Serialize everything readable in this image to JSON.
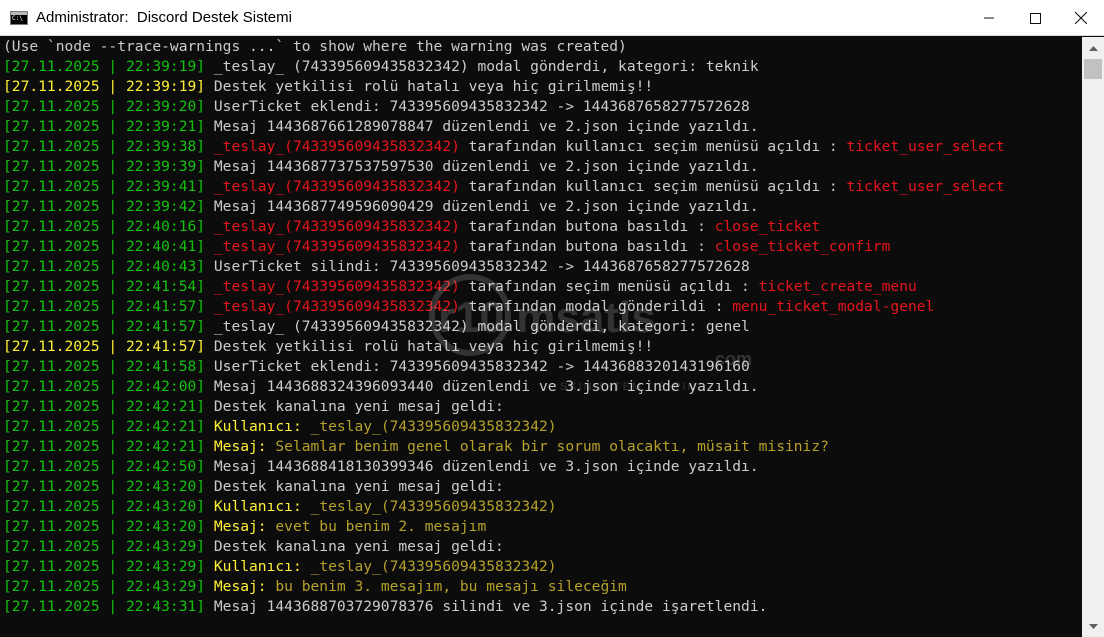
{
  "window": {
    "title": "Administrator:  Discord Destek Sistemi"
  },
  "colors": {
    "green": "#13c20e",
    "yellow": "#fff234",
    "white": "#cccccc",
    "red": "#e8141c",
    "dim_yellow": "#b5a12a"
  },
  "watermark": {
    "text": "r10 msatis",
    "sub": "SKIN / ITEM / E-PIN",
    "suffix": ".com"
  },
  "lines": [
    {
      "segments": [
        {
          "t": "(Use `node --trace-warnings ...` to show where the warning was created)",
          "c": "w"
        }
      ]
    },
    {
      "segments": [
        {
          "t": "[27.11.2025 | 22:39:19] ",
          "c": "g"
        },
        {
          "t": "_teslay_ (743395609435832342) modal gönderdi, kategori: teknik",
          "c": "w"
        }
      ]
    },
    {
      "segments": [
        {
          "t": "[27.11.2025 | 22:39:19] ",
          "c": "y"
        },
        {
          "t": "Destek yetkilisi rolü hatalı veya hiç girilmemiş!!",
          "c": "w"
        }
      ]
    },
    {
      "segments": [
        {
          "t": "[27.11.2025 | 22:39:20] ",
          "c": "g"
        },
        {
          "t": "UserTicket eklendi: 743395609435832342 -> 1443687658277572628",
          "c": "w"
        }
      ]
    },
    {
      "segments": [
        {
          "t": "[27.11.2025 | 22:39:21] ",
          "c": "g"
        },
        {
          "t": "Mesaj 1443687661289078847 düzenlendi ve 2.json içinde yazıldı.",
          "c": "w"
        }
      ]
    },
    {
      "segments": [
        {
          "t": "[27.11.2025 | 22:39:38] ",
          "c": "g"
        },
        {
          "t": "_teslay_(743395609435832342)",
          "c": "r"
        },
        {
          "t": " tarafından kullanıcı seçim menüsü açıldı : ",
          "c": "w"
        },
        {
          "t": "ticket_user_select",
          "c": "r"
        }
      ]
    },
    {
      "segments": [
        {
          "t": "[27.11.2025 | 22:39:39] ",
          "c": "g"
        },
        {
          "t": "Mesaj 1443687737537597530 düzenlendi ve 2.json içinde yazıldı.",
          "c": "w"
        }
      ]
    },
    {
      "segments": [
        {
          "t": "[27.11.2025 | 22:39:41] ",
          "c": "g"
        },
        {
          "t": "_teslay_(743395609435832342)",
          "c": "r"
        },
        {
          "t": " tarafından kullanıcı seçim menüsü açıldı : ",
          "c": "w"
        },
        {
          "t": "ticket_user_select",
          "c": "r"
        }
      ]
    },
    {
      "segments": [
        {
          "t": "[27.11.2025 | 22:39:42] ",
          "c": "g"
        },
        {
          "t": "Mesaj 1443687749596090429 düzenlendi ve 2.json içinde yazıldı.",
          "c": "w"
        }
      ]
    },
    {
      "segments": [
        {
          "t": "[27.11.2025 | 22:40:16] ",
          "c": "g"
        },
        {
          "t": "_teslay_(743395609435832342)",
          "c": "r"
        },
        {
          "t": " tarafından butona basıldı : ",
          "c": "w"
        },
        {
          "t": "close_ticket",
          "c": "r"
        }
      ]
    },
    {
      "segments": [
        {
          "t": "[27.11.2025 | 22:40:41] ",
          "c": "g"
        },
        {
          "t": "_teslay_(743395609435832342)",
          "c": "r"
        },
        {
          "t": " tarafından butona basıldı : ",
          "c": "w"
        },
        {
          "t": "close_ticket_confirm",
          "c": "r"
        }
      ]
    },
    {
      "segments": [
        {
          "t": "[27.11.2025 | 22:40:43] ",
          "c": "g"
        },
        {
          "t": "UserTicket silindi: 743395609435832342 -> 1443687658277572628",
          "c": "w"
        }
      ]
    },
    {
      "segments": [
        {
          "t": "[27.11.2025 | 22:41:54] ",
          "c": "g"
        },
        {
          "t": "_teslay_(743395609435832342)",
          "c": "r"
        },
        {
          "t": " tarafından seçim menüsü açıldı : ",
          "c": "w"
        },
        {
          "t": "ticket_create_menu",
          "c": "r"
        }
      ]
    },
    {
      "segments": [
        {
          "t": "[27.11.2025 | 22:41:57] ",
          "c": "g"
        },
        {
          "t": "_teslay_(743395609435832342)",
          "c": "r"
        },
        {
          "t": " tarafından modal gönderildi : ",
          "c": "w"
        },
        {
          "t": "menu_ticket_modal-genel",
          "c": "r"
        }
      ]
    },
    {
      "segments": [
        {
          "t": "[27.11.2025 | 22:41:57] ",
          "c": "g"
        },
        {
          "t": "_teslay_ (743395609435832342) modal gönderdi, kategori: genel",
          "c": "w"
        }
      ]
    },
    {
      "segments": [
        {
          "t": "[27.11.2025 | 22:41:57] ",
          "c": "y"
        },
        {
          "t": "Destek yetkilisi rolü hatalı veya hiç girilmemiş!!",
          "c": "w"
        }
      ]
    },
    {
      "segments": [
        {
          "t": "[27.11.2025 | 22:41:58] ",
          "c": "g"
        },
        {
          "t": "UserTicket eklendi: 743395609435832342 -> 1443688320143196160",
          "c": "w"
        }
      ]
    },
    {
      "segments": [
        {
          "t": "[27.11.2025 | 22:42:00] ",
          "c": "g"
        },
        {
          "t": "Mesaj 1443688324396093440 düzenlendi ve 3.json içinde yazıldı.",
          "c": "w"
        }
      ]
    },
    {
      "segments": [
        {
          "t": "[27.11.2025 | 22:42:21] ",
          "c": "g"
        },
        {
          "t": "Destek kanalına yeni mesaj geldi:",
          "c": "w"
        }
      ]
    },
    {
      "segments": [
        {
          "t": "[27.11.2025 | 22:42:21] ",
          "c": "g"
        },
        {
          "t": "Kullanıcı:",
          "c": "y"
        },
        {
          "t": " _teslay_(743395609435832342)",
          "c": "dy"
        }
      ]
    },
    {
      "segments": [
        {
          "t": "[27.11.2025 | 22:42:21] ",
          "c": "g"
        },
        {
          "t": "Mesaj:",
          "c": "y"
        },
        {
          "t": " Selamlar benim genel olarak bir sorum olacaktı, müsait misiniz?",
          "c": "dy"
        }
      ]
    },
    {
      "segments": [
        {
          "t": "[27.11.2025 | 22:42:50] ",
          "c": "g"
        },
        {
          "t": "Mesaj 1443688418130399346 düzenlendi ve 3.json içinde yazıldı.",
          "c": "w"
        }
      ]
    },
    {
      "segments": [
        {
          "t": "[27.11.2025 | 22:43:20] ",
          "c": "g"
        },
        {
          "t": "Destek kanalına yeni mesaj geldi:",
          "c": "w"
        }
      ]
    },
    {
      "segments": [
        {
          "t": "[27.11.2025 | 22:43:20] ",
          "c": "g"
        },
        {
          "t": "Kullanıcı:",
          "c": "y"
        },
        {
          "t": " _teslay_(743395609435832342)",
          "c": "dy"
        }
      ]
    },
    {
      "segments": [
        {
          "t": "[27.11.2025 | 22:43:20] ",
          "c": "g"
        },
        {
          "t": "Mesaj:",
          "c": "y"
        },
        {
          "t": " evet bu benim 2. mesajım",
          "c": "dy"
        }
      ]
    },
    {
      "segments": [
        {
          "t": "[27.11.2025 | 22:43:29] ",
          "c": "g"
        },
        {
          "t": "Destek kanalına yeni mesaj geldi:",
          "c": "w"
        }
      ]
    },
    {
      "segments": [
        {
          "t": "[27.11.2025 | 22:43:29] ",
          "c": "g"
        },
        {
          "t": "Kullanıcı:",
          "c": "y"
        },
        {
          "t": " _teslay_(743395609435832342)",
          "c": "dy"
        }
      ]
    },
    {
      "segments": [
        {
          "t": "[27.11.2025 | 22:43:29] ",
          "c": "g"
        },
        {
          "t": "Mesaj:",
          "c": "y"
        },
        {
          "t": " bu benim 3. mesajım, bu mesajı sileceğim",
          "c": "dy"
        }
      ]
    },
    {
      "segments": [
        {
          "t": "[27.11.2025 | 22:43:31] ",
          "c": "g"
        },
        {
          "t": "Mesaj 1443688703729078376 silindi ve 3.json içinde işaretlendi.",
          "c": "w"
        }
      ]
    }
  ]
}
